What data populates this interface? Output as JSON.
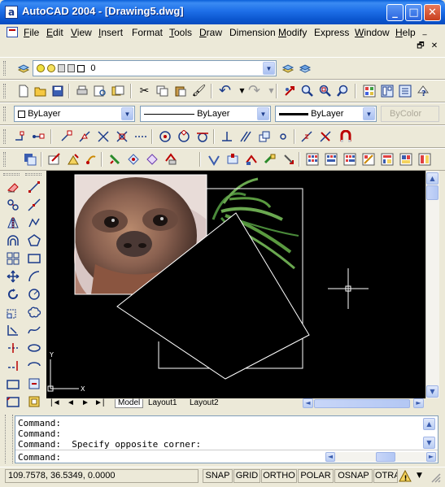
{
  "window": {
    "title": "AutoCAD 2004 - [Drawing5.dwg]",
    "app_icon": "a",
    "minimize": "_",
    "maximize": "□",
    "close": "✕"
  },
  "menu": {
    "items": [
      {
        "label": "File",
        "u": "F",
        "rest": "ile"
      },
      {
        "label": "Edit",
        "u": "E",
        "rest": "dit"
      },
      {
        "label": "View",
        "u": "V",
        "rest": "iew"
      },
      {
        "label": "Insert",
        "u": "I",
        "rest": "nsert"
      },
      {
        "label": "Format",
        "u": "",
        "rest": "Format"
      },
      {
        "label": "Tools",
        "u": "T",
        "rest": "ools"
      },
      {
        "label": "Draw",
        "u": "D",
        "rest": "raw"
      },
      {
        "label": "Dimension",
        "u": "",
        "rest": "Dimension"
      },
      {
        "label": "Modify",
        "u": "M",
        "rest": "odify"
      },
      {
        "label": "Express",
        "u": "",
        "rest": "Express"
      },
      {
        "label": "Window",
        "u": "W",
        "rest": "indow"
      },
      {
        "label": "Help",
        "u": "H",
        "rest": "elp"
      }
    ],
    "mdi": {
      "minimize": "_",
      "restore": "🗗",
      "close": "✕"
    }
  },
  "layers": {
    "current_layer": "0"
  },
  "properties": {
    "color": "ByLayer",
    "linetype": "ByLayer",
    "lineweight": "ByLayer",
    "plotstyle": "ByColor"
  },
  "layout_tabs": {
    "nav": [
      "|◄",
      "◄",
      "►",
      "►|"
    ],
    "tabs": [
      "Model",
      "Layout1",
      "Layout2"
    ]
  },
  "ucs": {
    "x": "X",
    "y": "Y"
  },
  "command": {
    "lines": [
      "Command:",
      "Command:",
      "Command:  Specify opposite corner:",
      "Command:"
    ]
  },
  "status": {
    "coordinates": "109.7578, 36.5349, 0.0000",
    "toggles": [
      "SNAP",
      "GRID",
      "ORTHO",
      "POLAR",
      "OSNAP",
      "OTRACK"
    ]
  },
  "colors": {
    "titlebar": "#0A5FD8",
    "drawing_background": "#000000",
    "chrome": "#ECE9D8"
  }
}
